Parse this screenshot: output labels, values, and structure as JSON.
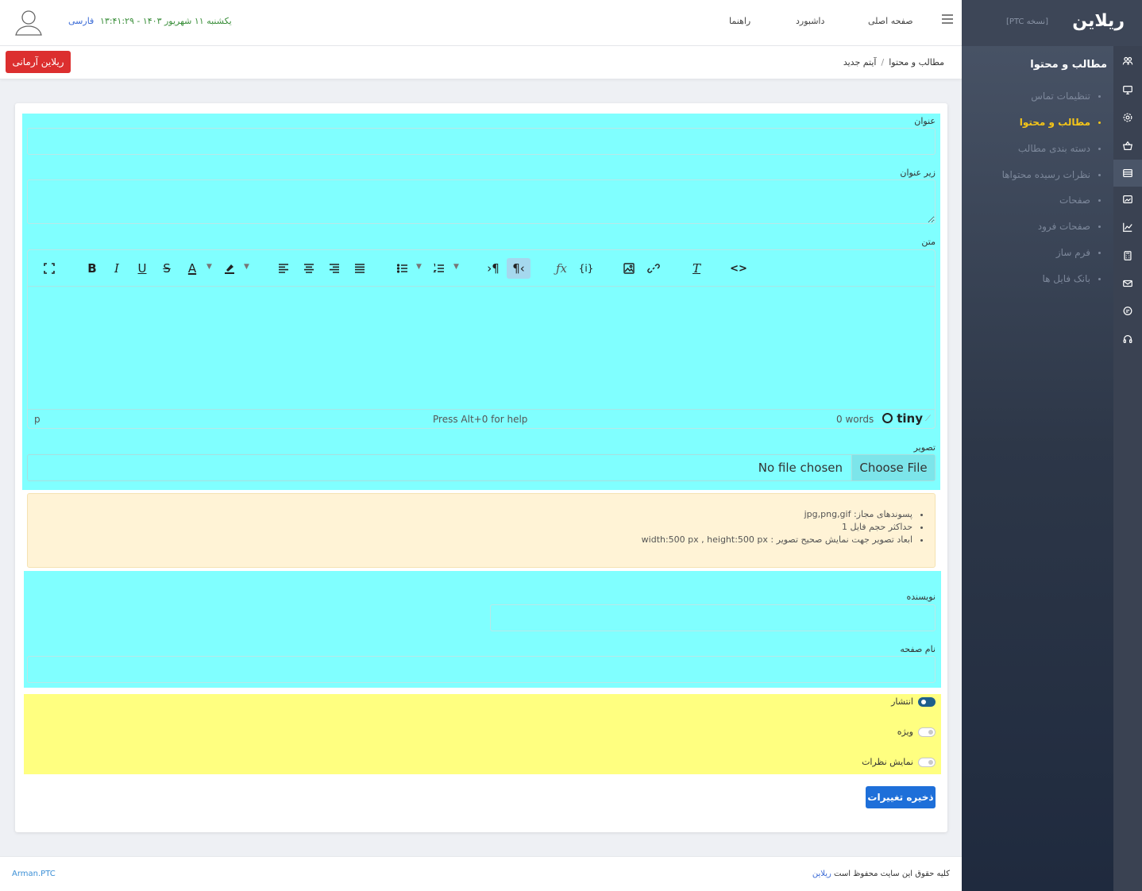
{
  "sidebar": {
    "logo": "ریلاین",
    "version": "[نسخه PTC]",
    "section_title": "مطالب و محتوا",
    "items": [
      {
        "label": "تنظیمات تماس",
        "active": false
      },
      {
        "label": "مطالب و محتوا",
        "active": true
      },
      {
        "label": "دسته بندی مطالب",
        "active": false
      },
      {
        "label": "نظرات رسیده محتواها",
        "active": false
      },
      {
        "label": "صفحات",
        "active": false
      },
      {
        "label": "صفحات فرود",
        "active": false
      },
      {
        "label": "فرم ساز",
        "active": false
      },
      {
        "label": "بانک فایل ها",
        "active": false
      }
    ],
    "rail_icons": [
      "users-icon",
      "monitor-icon",
      "gear-icon",
      "basket-icon",
      "table-icon",
      "image-icon",
      "chart-icon",
      "calculator-icon",
      "mail-icon",
      "chat-icon",
      "headset-icon"
    ]
  },
  "header": {
    "nav": [
      "صفحه اصلی",
      "داشبورد",
      "راهنما"
    ],
    "datetime": "یکشنبه ۱۱ شهریور ۱۴۰۳ - ۱۳:۴۱:۲۹",
    "language": "فارسی"
  },
  "breadcrumb": {
    "parent": "مطالب و محتوا",
    "current": "آیتم جدید"
  },
  "arman_button": "ریلاین آرمانی",
  "form": {
    "title_label": "عنوان",
    "subtitle_label": "زیر عنوان",
    "body_label": "متن",
    "image_label": "تصویر",
    "author_label": "نویسنده",
    "page_name_label": "نام صفحه",
    "choose_file": "Choose File",
    "no_file": "No file chosen"
  },
  "editor": {
    "path": "p",
    "help": "Press Alt+0 for help",
    "words": "0 words",
    "brand": "tiny"
  },
  "info": [
    "پسوندهای مجاز: jpg,png,gif",
    "حداکثر حجم فایل 1",
    "ابعاد تصویر جهت نمایش صحیح تصویر : width:500 px , height:500 px"
  ],
  "switches": [
    {
      "label": "انتشار",
      "on": true
    },
    {
      "label": "ویژه",
      "on": false
    },
    {
      "label": "نمایش نظرات",
      "on": false
    }
  ],
  "save_button": "ذخیره تغییرات",
  "footer": {
    "copyright_prefix": "کلیه حقوق این سایت محفوظ است",
    "copyright_link": "ریلاین",
    "credit": "Arman.PTC"
  },
  "colors": {
    "accent": "#f5c518",
    "primary": "#1e6fd9",
    "danger": "#dc2f2f",
    "highlight_cyan": "#80ffff",
    "highlight_yellow": "#ffff80"
  }
}
